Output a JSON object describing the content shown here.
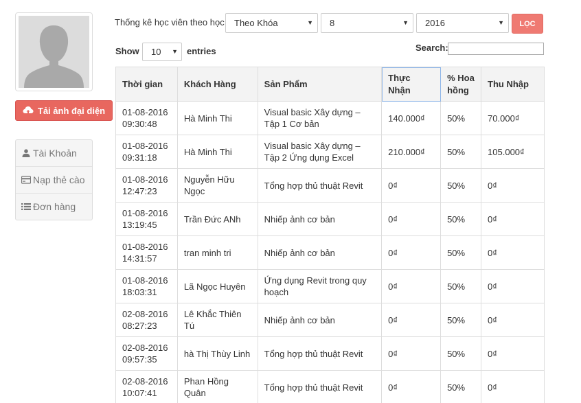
{
  "sidebar": {
    "upload_button": "Tải ảnh đại diện",
    "menu": [
      {
        "label": "Tài Khoản",
        "icon": "user-icon"
      },
      {
        "label": "Nạp thẻ cào",
        "icon": "credit-card-icon"
      },
      {
        "label": "Đơn hàng",
        "icon": "list-icon"
      }
    ]
  },
  "filter": {
    "label": "Thống kê học viên theo học",
    "type_value": "Theo Khóa",
    "month_value": "8",
    "year_value": "2016",
    "button_label": "LỌC"
  },
  "table_controls": {
    "show_label": "Show",
    "entries_value": "10",
    "entries_label": "entries",
    "search_label": "Search:"
  },
  "table": {
    "headers": [
      "Thời gian",
      "Khách Hàng",
      "Sản Phẩm",
      "Thực Nhận",
      "% Hoa hồng",
      "Thu Nhập"
    ],
    "rows": [
      [
        "01-08-2016 09:30:48",
        "Hà Minh Thi",
        "Visual basic Xây dựng – Tập 1 Cơ bản",
        "140.000₫",
        "50%",
        "70.000₫"
      ],
      [
        "01-08-2016 09:31:18",
        "Hà Minh Thi",
        "Visual basic Xây dựng – Tập 2 Ứng dụng Excel",
        "210.000₫",
        "50%",
        "105.000₫"
      ],
      [
        "01-08-2016 12:47:23",
        "Nguyễn Hữu Ngọc",
        "Tổng hợp thủ thuật Revit",
        "0₫",
        "50%",
        "0₫"
      ],
      [
        "01-08-2016 13:19:45",
        "Trần Đức ANh",
        "Nhiếp ảnh cơ bản",
        "0₫",
        "50%",
        "0₫"
      ],
      [
        "01-08-2016 14:31:57",
        "tran minh tri",
        "Nhiếp ảnh cơ bản",
        "0₫",
        "50%",
        "0₫"
      ],
      [
        "01-08-2016 18:03:31",
        "Lã Ngọc Huyên",
        "Ứng dụng Revit trong quy hoạch",
        "0₫",
        "50%",
        "0₫"
      ],
      [
        "02-08-2016 08:27:23",
        "Lê Khắc Thiên Tú",
        "Nhiếp ảnh cơ bản",
        "0₫",
        "50%",
        "0₫"
      ],
      [
        "02-08-2016 09:57:35",
        "hà Thị Thùy Linh",
        "Tổng hợp thủ thuật Revit",
        "0₫",
        "50%",
        "0₫"
      ],
      [
        "02-08-2016 10:07:41",
        "Phan Hồng Quân",
        "Tổng hợp thủ thuật Revit",
        "0₫",
        "50%",
        "0₫"
      ]
    ]
  }
}
